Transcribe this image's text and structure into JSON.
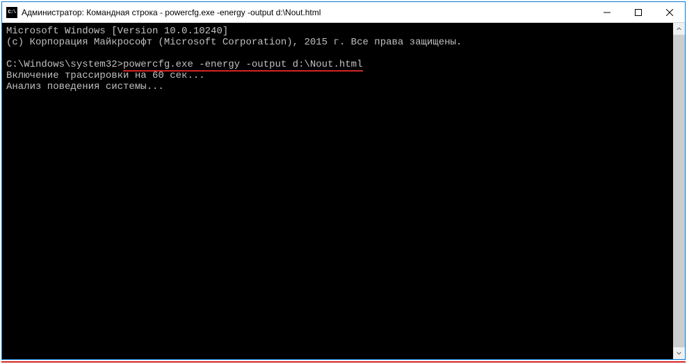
{
  "window": {
    "title": "Администратор: Командная строка - powercfg.exe  -energy -output d:\\Nout.html"
  },
  "terminal": {
    "line1": "Microsoft Windows [Version 10.0.10240]",
    "line2": "(c) Корпорация Майкрософт (Microsoft Corporation), 2015 г. Все права защищены.",
    "line3_prompt": "C:\\Windows\\system32>",
    "line3_cmd": "powercfg.exe -energy -output d:\\Nout.html",
    "line4": "Включение трассировки на 60 сек...",
    "line5": "Анализ поведения системы..."
  }
}
